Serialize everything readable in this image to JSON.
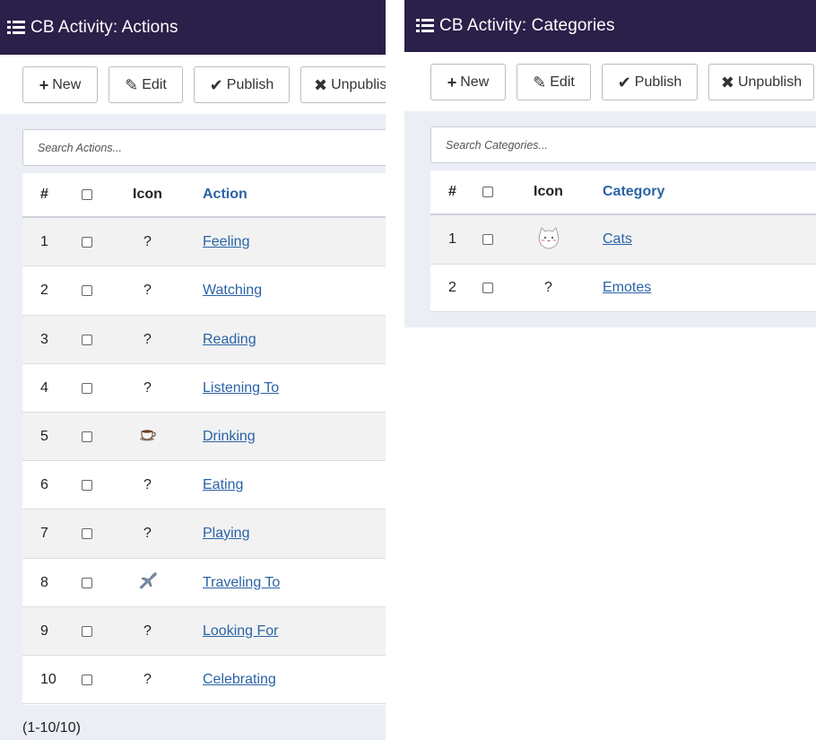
{
  "actions_panel": {
    "title": "CB Activity: Actions",
    "toolbar": {
      "new_label": "New",
      "edit_label": "Edit",
      "publish_label": "Publish",
      "unpublish_label": "Unpublish"
    },
    "search_placeholder": "Search Actions...",
    "columns": {
      "num": "#",
      "icon": "Icon",
      "name": "Action"
    },
    "rows": [
      {
        "num": "1",
        "icon": "?",
        "name": "Feeling"
      },
      {
        "num": "2",
        "icon": "?",
        "name": "Watching"
      },
      {
        "num": "3",
        "icon": "?",
        "name": "Reading"
      },
      {
        "num": "4",
        "icon": "?",
        "name": "Listening To"
      },
      {
        "num": "5",
        "icon": "coffee-cup-icon",
        "name": "Drinking"
      },
      {
        "num": "6",
        "icon": "?",
        "name": "Eating"
      },
      {
        "num": "7",
        "icon": "?",
        "name": "Playing"
      },
      {
        "num": "8",
        "icon": "airplane-icon",
        "name": "Traveling To"
      },
      {
        "num": "9",
        "icon": "?",
        "name": "Looking For"
      },
      {
        "num": "10",
        "icon": "?",
        "name": "Celebrating"
      }
    ],
    "pagination": "(1-10/10)"
  },
  "categories_panel": {
    "title": "CB Activity: Categories",
    "toolbar": {
      "new_label": "New",
      "edit_label": "Edit",
      "publish_label": "Publish",
      "unpublish_label": "Unpublish"
    },
    "search_placeholder": "Search Categories...",
    "columns": {
      "num": "#",
      "icon": "Icon",
      "name": "Category"
    },
    "rows": [
      {
        "num": "1",
        "icon": "cat-image-icon",
        "name": "Cats"
      },
      {
        "num": "2",
        "icon": "?",
        "name": "Emotes"
      }
    ]
  },
  "colors": {
    "titlebar": "#2a2049",
    "link": "#2a63a6",
    "panel_bg": "#eceef5"
  }
}
